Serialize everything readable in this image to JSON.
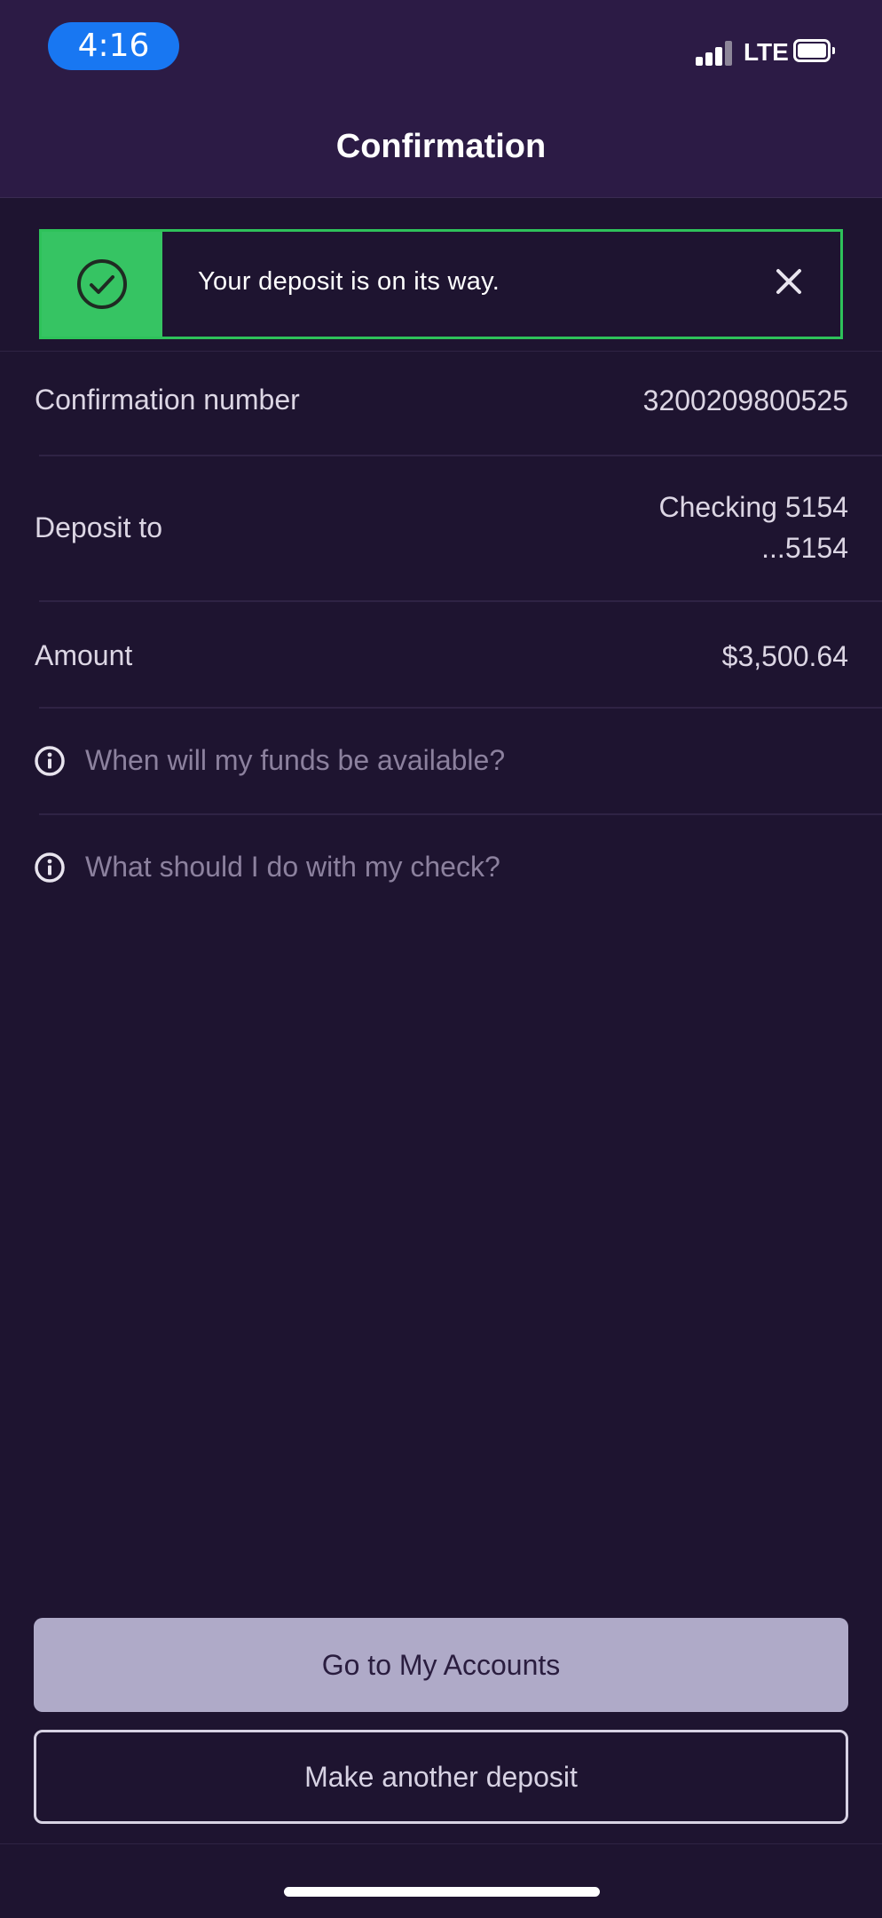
{
  "status_bar": {
    "time": "4:16",
    "network": "LTE",
    "icons": [
      "signal-icon",
      "battery-icon"
    ]
  },
  "header": {
    "title": "Confirmation"
  },
  "banner": {
    "message": "Your deposit is on its way.",
    "status_icon": "check-circle-icon",
    "close_icon": "close-icon",
    "accent_color": "#36c463"
  },
  "details": {
    "confirmation_label": "Confirmation number",
    "confirmation_value": "3200209800525",
    "deposit_to_label": "Deposit to",
    "deposit_to_value_line1": "Checking 5154",
    "deposit_to_value_line2": "...5154",
    "amount_label": "Amount",
    "amount_value": "$3,500.64"
  },
  "info_links": [
    {
      "icon": "info-icon",
      "label": "When will my funds be available?"
    },
    {
      "icon": "info-icon",
      "label": "What should I do with my check?"
    }
  ],
  "actions": {
    "primary_label": "Go to My Accounts",
    "secondary_label": "Make another deposit"
  },
  "colors": {
    "background": "#1e1430",
    "header": "#2c1b45",
    "primary_button": "#afaac8",
    "success": "#36c463"
  }
}
